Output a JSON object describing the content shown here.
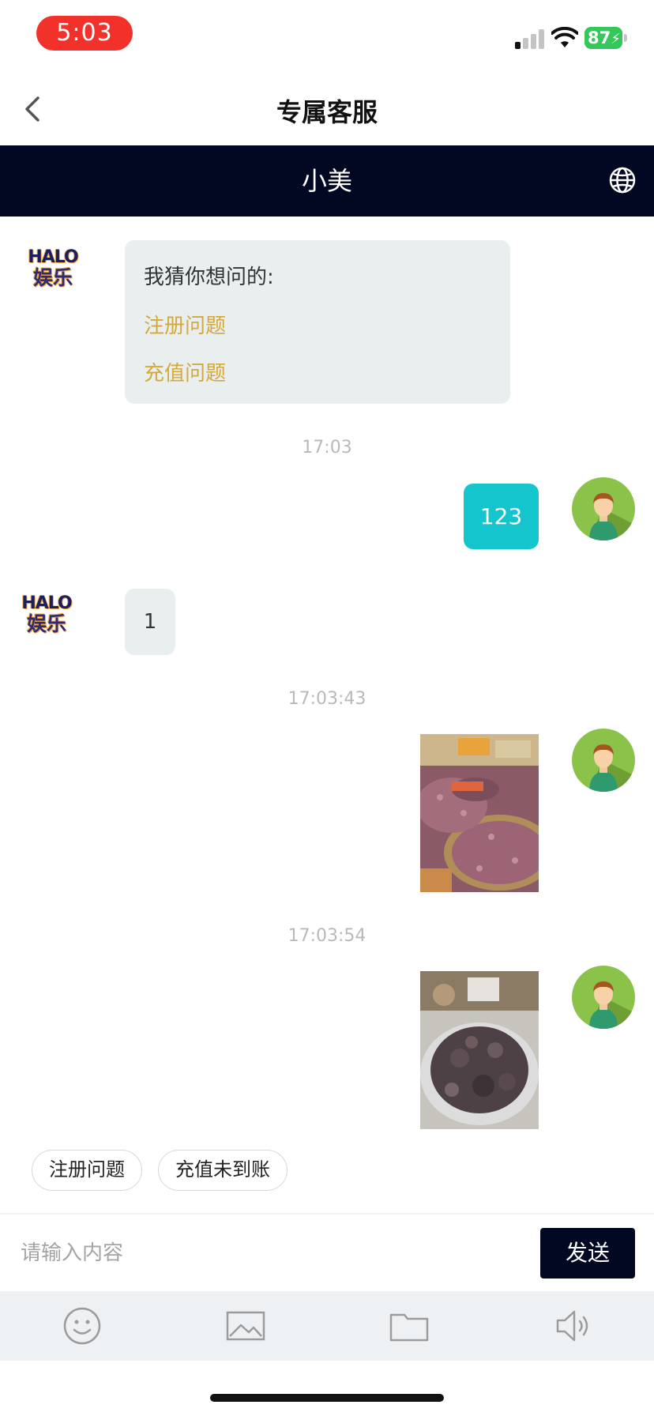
{
  "status_bar": {
    "time": "5:03",
    "battery": "87"
  },
  "nav": {
    "title": "专属客服"
  },
  "agent": {
    "name": "小美"
  },
  "logo": {
    "line1": "HALO",
    "line2": "娱乐"
  },
  "suggest": {
    "title": "我猜你想问的:",
    "links": [
      "注册问题",
      "充值问题"
    ]
  },
  "messages": [
    {
      "time": "17:03",
      "from": "user",
      "text": "123"
    },
    {
      "from": "agent",
      "text": "1"
    },
    {
      "time": "17:03:43",
      "from": "user",
      "type": "image"
    },
    {
      "time": "17:03:54",
      "from": "user",
      "type": "image"
    }
  ],
  "quick_replies": [
    "注册问题",
    "充值未到账"
  ],
  "input": {
    "placeholder": "请输入内容",
    "send_label": "发送"
  },
  "toolbar": [
    "emoji-icon",
    "image-icon",
    "folder-icon",
    "voice-icon"
  ],
  "colors": {
    "header_bg": "#020822",
    "user_bubble": "#15c5cd",
    "link": "#d4a93c",
    "time_pill": "#f2312b"
  }
}
